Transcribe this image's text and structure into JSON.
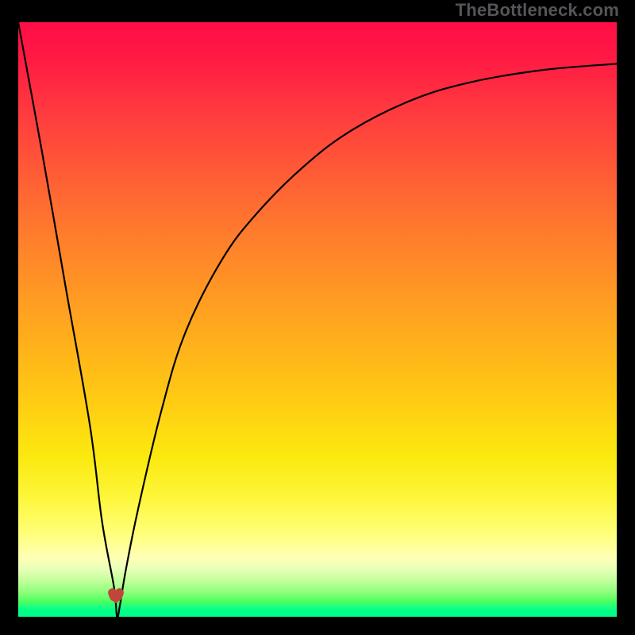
{
  "watermark": {
    "text": "TheBottleneck.com"
  },
  "chart_data": {
    "type": "line",
    "title": "",
    "xlabel": "",
    "ylabel": "",
    "xlim": [
      0,
      100
    ],
    "ylim": [
      0,
      100
    ],
    "grid": false,
    "legend": false,
    "background": "rainbow-vertical (red→orange→yellow→green, bottleneck gradient)",
    "series": [
      {
        "name": "bottleneck-curve",
        "x": [
          0,
          4,
          8,
          12,
          14,
          16,
          16.5,
          17,
          18,
          20,
          24,
          28,
          34,
          40,
          48,
          56,
          66,
          76,
          88,
          100
        ],
        "values": [
          100,
          78,
          55,
          32,
          16,
          5,
          0,
          2,
          8,
          18,
          35,
          48,
          60,
          68,
          76,
          82,
          87,
          90,
          92,
          93
        ]
      }
    ],
    "markers": [
      {
        "name": "sweet-spot-heart",
        "x": 16.3,
        "y": 3.5,
        "symbol": "heart",
        "color": "#c0453a"
      }
    ]
  }
}
